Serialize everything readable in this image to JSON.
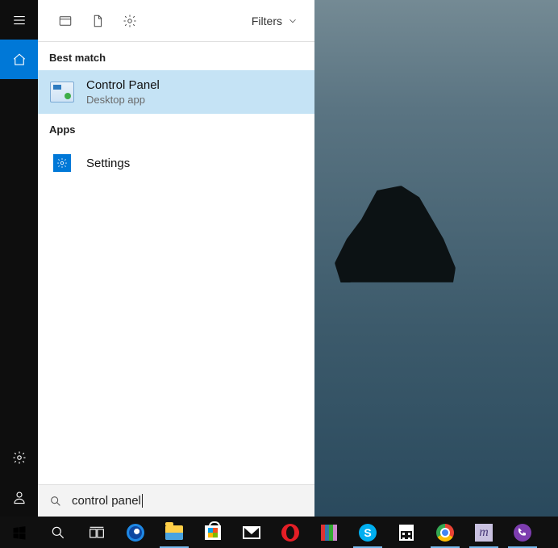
{
  "search": {
    "query": "control panel",
    "filters_label": "Filters"
  },
  "sections": {
    "best_match": "Best match",
    "apps": "Apps"
  },
  "results": {
    "control_panel": {
      "title": "Control Panel",
      "subtitle": "Desktop app"
    },
    "settings": {
      "title": "Settings"
    }
  },
  "rail": {
    "menu": "menu",
    "home": "home",
    "settings": "settings",
    "account": "account"
  },
  "taskbar": {
    "start": "Start",
    "search": "Search",
    "taskview": "Task View",
    "apps": [
      {
        "name": "edge",
        "running": false
      },
      {
        "name": "file-explorer",
        "running": true
      },
      {
        "name": "store",
        "running": false
      },
      {
        "name": "mail",
        "running": false
      },
      {
        "name": "opera",
        "running": false
      },
      {
        "name": "books",
        "running": false
      },
      {
        "name": "skype",
        "running": true
      },
      {
        "name": "calculator",
        "running": false
      },
      {
        "name": "chrome",
        "running": true
      },
      {
        "name": "app-m",
        "running": true
      },
      {
        "name": "viber",
        "running": true
      }
    ]
  }
}
